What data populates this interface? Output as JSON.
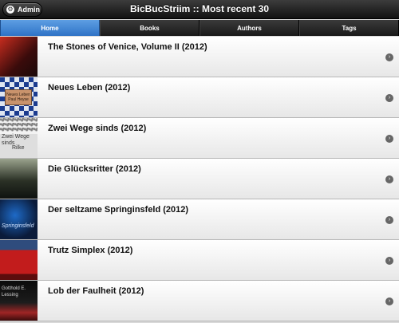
{
  "header": {
    "admin_label": "Admin",
    "title": "BicBucStriim :: Most recent 30"
  },
  "navbar": {
    "tabs": [
      {
        "label": "Home"
      },
      {
        "label": "Books"
      },
      {
        "label": "Authors"
      },
      {
        "label": "Tags"
      }
    ]
  },
  "books": [
    {
      "title": "The Stones of Venice, Volume II (2012)"
    },
    {
      "title": "Neues Leben (2012)",
      "cover_text": "Neues Leben Paul Heyse"
    },
    {
      "title": "Zwei Wege sinds (2012)",
      "cover_text": "Zwei Wege sinds",
      "cover_text2": "Rilke"
    },
    {
      "title": "Die Glücksritter (2012)"
    },
    {
      "title": "Der seltzame Springinsfeld (2012)",
      "cover_text": "Springinsfeld"
    },
    {
      "title": "Trutz Simplex (2012)"
    },
    {
      "title": "Lob der Faulheit (2012)",
      "cover_text": "Gotthold E. Lessing"
    }
  ],
  "colors": {
    "header_bg": "#1a1a1a",
    "active_tab": "#3f86d6",
    "row_bg": "#f3f3f3"
  },
  "icons": {
    "admin": "gear-icon",
    "row_arrow": "chevron-right-icon"
  }
}
